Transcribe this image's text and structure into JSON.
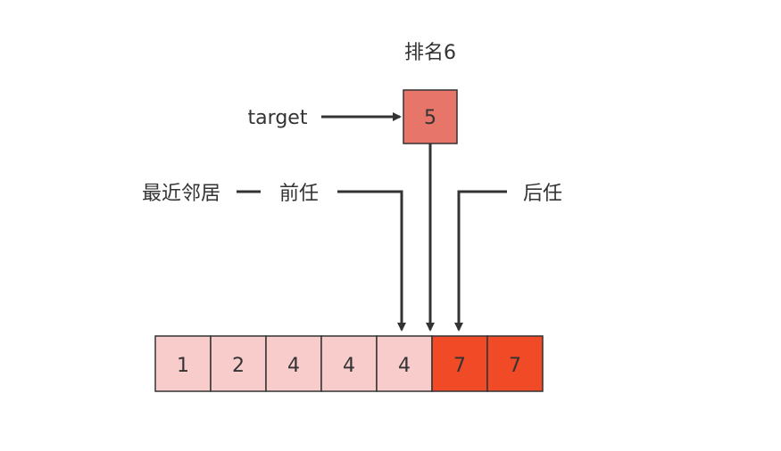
{
  "diagram": {
    "rank_label": "排名6",
    "target_label": "target",
    "target_value": "5",
    "nearest_label": "最近邻居",
    "prev_label": "前任",
    "next_label": "后任",
    "array": [
      {
        "value": "1",
        "highlight": false
      },
      {
        "value": "2",
        "highlight": false
      },
      {
        "value": "4",
        "highlight": false
      },
      {
        "value": "4",
        "highlight": false
      },
      {
        "value": "4",
        "highlight": false
      },
      {
        "value": "7",
        "highlight": true
      },
      {
        "value": "7",
        "highlight": true
      }
    ],
    "colors": {
      "normal_cell": "#f9cccc",
      "highlight_cell": "#f04a26",
      "target_cell": "#e8756a",
      "arrow": "#333333"
    }
  }
}
